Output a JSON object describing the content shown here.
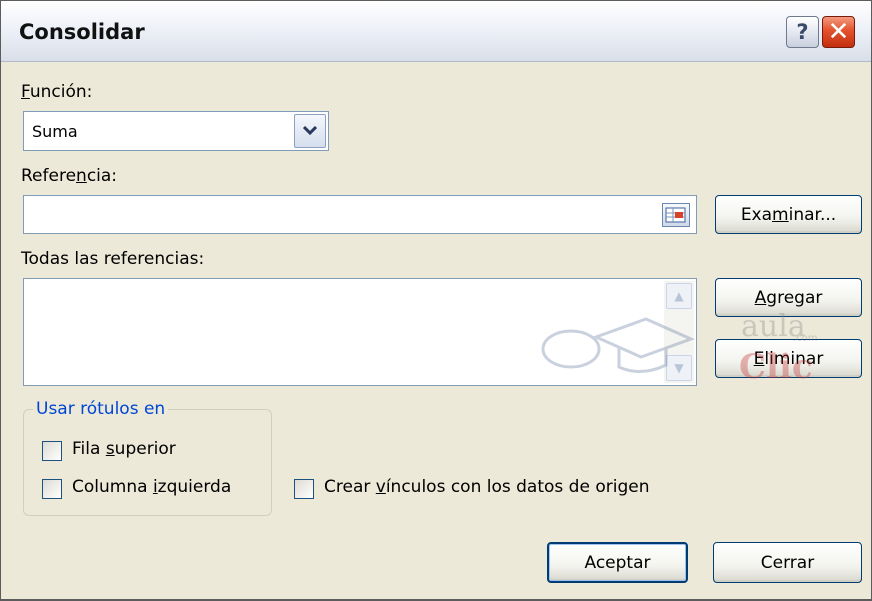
{
  "window": {
    "title": "Consolidar"
  },
  "titlebar": {
    "help_label": "?",
    "close_label": "✕"
  },
  "funcion": {
    "label_hotkey": "F",
    "label_rest": "unción:",
    "selected": "Suma"
  },
  "referencia": {
    "label_pre": "Refere",
    "label_hotkey": "n",
    "label_post": "cia:",
    "value": ""
  },
  "examinar_button": {
    "pre": "Exa",
    "hotkey": "m",
    "post": "inar..."
  },
  "todas": {
    "label": "Todas las referencias:"
  },
  "agregar_button": {
    "hotkey": "A",
    "post": "gregar"
  },
  "eliminar_button": {
    "hotkey": "E",
    "post": "liminar"
  },
  "usar_rotulos": {
    "legend": "Usar rótulos en",
    "fila_pre": "Fila ",
    "fila_hotkey": "s",
    "fila_post": "uperior",
    "fila_checked": false,
    "columna_pre": "Columna ",
    "columna_hotkey": "i",
    "columna_post": "zquierda",
    "columna_checked": false
  },
  "crear_vinculos": {
    "pre": "Crear ",
    "hotkey": "v",
    "post": "ínculos con los datos de origen",
    "checked": false
  },
  "footer": {
    "aceptar_label": "Aceptar",
    "cerrar_label": "Cerrar"
  },
  "watermark": {
    "text_top": "aula",
    "text_com": ".com",
    "text_bottom": "Clic"
  },
  "colors": {
    "accent_blue": "#0046d5",
    "close_red": "#e3522c",
    "dialog_bg": "#ece9d8"
  }
}
